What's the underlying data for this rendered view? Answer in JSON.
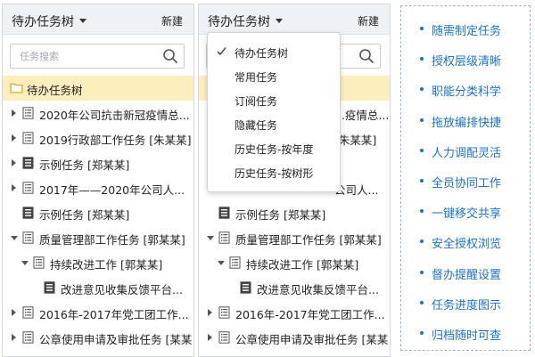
{
  "colors": {
    "header_bg": "#eef2f7",
    "selected_root_bg": "#fdeebe",
    "feature_text": "#1b73c7",
    "feature_border": "#9fb7d1",
    "folder_icon": "#d9a92f"
  },
  "left_panel": {
    "title": "待办任务树",
    "new_label": "新建",
    "search_placeholder": "任务搜索",
    "tree": [
      {
        "label": "待办任务树",
        "icon": "folder-icon",
        "arrow": "none",
        "level": 0,
        "root": true
      },
      {
        "label": "2020年公司抗击新冠疫情总...",
        "icon": "task-list-icon",
        "arrow": "right",
        "level": 0
      },
      {
        "label": "2019行政部工作任务 [朱某某]",
        "icon": "task-list-icon",
        "arrow": "right",
        "level": 0
      },
      {
        "label": "示例任务 [郑某某]",
        "icon": "task-doc-icon",
        "arrow": "right",
        "level": 0
      },
      {
        "label": "2017年——2020年公司人...",
        "icon": "task-list-icon",
        "arrow": "right",
        "level": 0
      },
      {
        "label": "示例任务 [郑某某]",
        "icon": "task-doc-icon",
        "arrow": "none",
        "level": 0
      },
      {
        "label": "质量管理部工作任务 [郭某某]",
        "icon": "task-list-icon",
        "arrow": "down",
        "level": 0
      },
      {
        "label": "持续改进工作 [郭某某]",
        "icon": "task-list-icon",
        "arrow": "down",
        "level": 1
      },
      {
        "label": "改进意见收集反馈平台...",
        "icon": "task-doc-icon",
        "arrow": "none",
        "level": 2
      },
      {
        "label": "2016年-2017年党工团工作...",
        "icon": "task-list-icon",
        "arrow": "right",
        "level": 0
      },
      {
        "label": "公章使用申请及审批任务 [某某]",
        "icon": "task-list-icon",
        "arrow": "right",
        "level": 0
      }
    ]
  },
  "mid_panel": {
    "title": "待办任务树",
    "new_label": "新建",
    "search_placeholder": "",
    "tree": [
      {
        "label": "",
        "icon": "none",
        "arrow": "none",
        "level": 0,
        "root": true
      },
      {
        "label": "...疫情总...",
        "icon": "none",
        "arrow": "none",
        "level": 0,
        "hidden_prefix": true
      },
      {
        "label": "[朱某某]",
        "icon": "none",
        "arrow": "none",
        "level": 0,
        "hidden_prefix": true
      },
      {
        "label": "",
        "icon": "none",
        "arrow": "none",
        "level": 0
      },
      {
        "label": "公司人...",
        "icon": "none",
        "arrow": "none",
        "level": 0,
        "hidden_prefix": true
      },
      {
        "label": "示例任务 [郑某某]",
        "icon": "task-doc-icon",
        "arrow": "none",
        "level": 0
      },
      {
        "label": "质量管理部工作任务 [郭某某]",
        "icon": "task-list-icon",
        "arrow": "down",
        "level": 0
      },
      {
        "label": "持续改进工作 [郭某某]",
        "icon": "task-list-icon",
        "arrow": "down",
        "level": 1
      },
      {
        "label": "改进意见收集反馈平台...",
        "icon": "task-doc-icon",
        "arrow": "none",
        "level": 2
      },
      {
        "label": "2016年-2017年党工团工作...",
        "icon": "task-list-icon",
        "arrow": "right",
        "level": 0
      },
      {
        "label": "公章使用申请及审批任务 [某某]",
        "icon": "task-list-icon",
        "arrow": "right",
        "level": 0
      }
    ]
  },
  "dropdown": {
    "items": [
      {
        "label": "待办任务树",
        "checked": true
      },
      {
        "label": "常用任务",
        "checked": false
      },
      {
        "label": "订阅任务",
        "checked": false
      },
      {
        "label": "隐藏任务",
        "checked": false
      },
      {
        "label": "历史任务-按年度",
        "checked": false
      },
      {
        "label": "历史任务-按树形",
        "checked": false
      }
    ]
  },
  "features": [
    "随需制定任务",
    "授权层级清晰",
    "职能分类科学",
    "拖放编排快捷",
    "人力调配灵活",
    "全员协同工作",
    "一键移交共享",
    "安全授权浏览",
    "督办提醒设置",
    "任务进度图示",
    "归档随时可查"
  ]
}
